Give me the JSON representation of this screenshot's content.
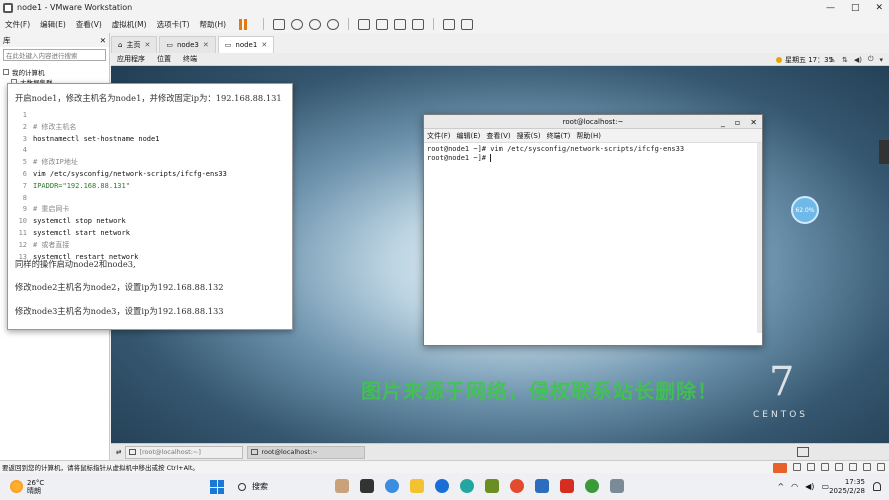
{
  "window": {
    "title": "node1 - VMware Workstation",
    "controls": {
      "minimize": "—",
      "maximize": "□",
      "close": "✕"
    }
  },
  "menubar": {
    "items": [
      "文件(F)",
      "编辑(E)",
      "查看(V)",
      "虚拟机(M)",
      "选项卡(T)",
      "帮助(H)"
    ]
  },
  "library": {
    "header": "库",
    "close": "✕",
    "search_placeholder": "在此处键入内容进行搜索",
    "tree": [
      "我的计算机",
      "大数据集群"
    ]
  },
  "vm_tabs": [
    {
      "label": "主页",
      "close": "✕"
    },
    {
      "label": "node3",
      "close": "✕"
    },
    {
      "label": "node1",
      "close": "✕"
    }
  ],
  "guest": {
    "top_menu": [
      "应用程序",
      "位置",
      "终端"
    ],
    "clock": "星期五 17：35",
    "terminal": {
      "title": "root@localhost:~",
      "controls": {
        "minimize": "_",
        "maximize": "▫",
        "close": "✕"
      },
      "menu": [
        "文件(F)",
        "编辑(E)",
        "查看(V)",
        "搜索(S)",
        "终端(T)",
        "帮助(H)"
      ],
      "lines": [
        "root@node1 ~]# vim /etc/sysconfig/network-scripts/ifcfg-ens33",
        "root@node1 ~]# "
      ]
    },
    "watermark": "图片来源于网络，侵权联系站长删除！",
    "brand_number": "7",
    "brand_word": "CENTOS",
    "floater_text": "62.0%",
    "taskbar": [
      "[root@localhost:~]",
      "root@localhost:~"
    ]
  },
  "doc": {
    "heading": "开启node1，修改主机名为node1，并修改固定ip为：192.168.88.131",
    "code": [
      {
        "n": "1",
        "text": "",
        "kind": "plain"
      },
      {
        "n": "2",
        "text": "# 修改主机名",
        "kind": "cmt"
      },
      {
        "n": "3",
        "text": "hostnamectl set-hostname node1",
        "kind": "plain"
      },
      {
        "n": "4",
        "text": "",
        "kind": "plain"
      },
      {
        "n": "5",
        "text": "# 修改IP地址",
        "kind": "cmt"
      },
      {
        "n": "6",
        "text": "vim /etc/sysconfig/network-scripts/ifcfg-ens33",
        "kind": "plain"
      },
      {
        "n": "7",
        "text": "IPADDR=\"192.168.88.131\"",
        "kind": "str"
      },
      {
        "n": "8",
        "text": "",
        "kind": "plain"
      },
      {
        "n": "9",
        "text": "# 重启网卡",
        "kind": "cmt"
      },
      {
        "n": "10",
        "text": "systemctl stop network",
        "kind": "plain"
      },
      {
        "n": "11",
        "text": "systemctl start network",
        "kind": "plain"
      },
      {
        "n": "12",
        "text": "# 或者直接",
        "kind": "cmt"
      },
      {
        "n": "13",
        "text": "systemctl restart network",
        "kind": "plain"
      }
    ],
    "para1": "同样的操作启动node2和node3,",
    "para2": "修改node2主机名为node2，设置ip为192.168.88.132",
    "para3": "修改node3主机名为node3，设置ip为192.168.88.133"
  },
  "status": "要返回到您的计算机，请将鼠标指针从虚拟机中移出或按 Ctrl+Alt。",
  "taskbar": {
    "weather_temp": "26°C",
    "weather_text": "晴朗",
    "search": "搜索",
    "time": "17:35",
    "date": "2025/2/28"
  }
}
